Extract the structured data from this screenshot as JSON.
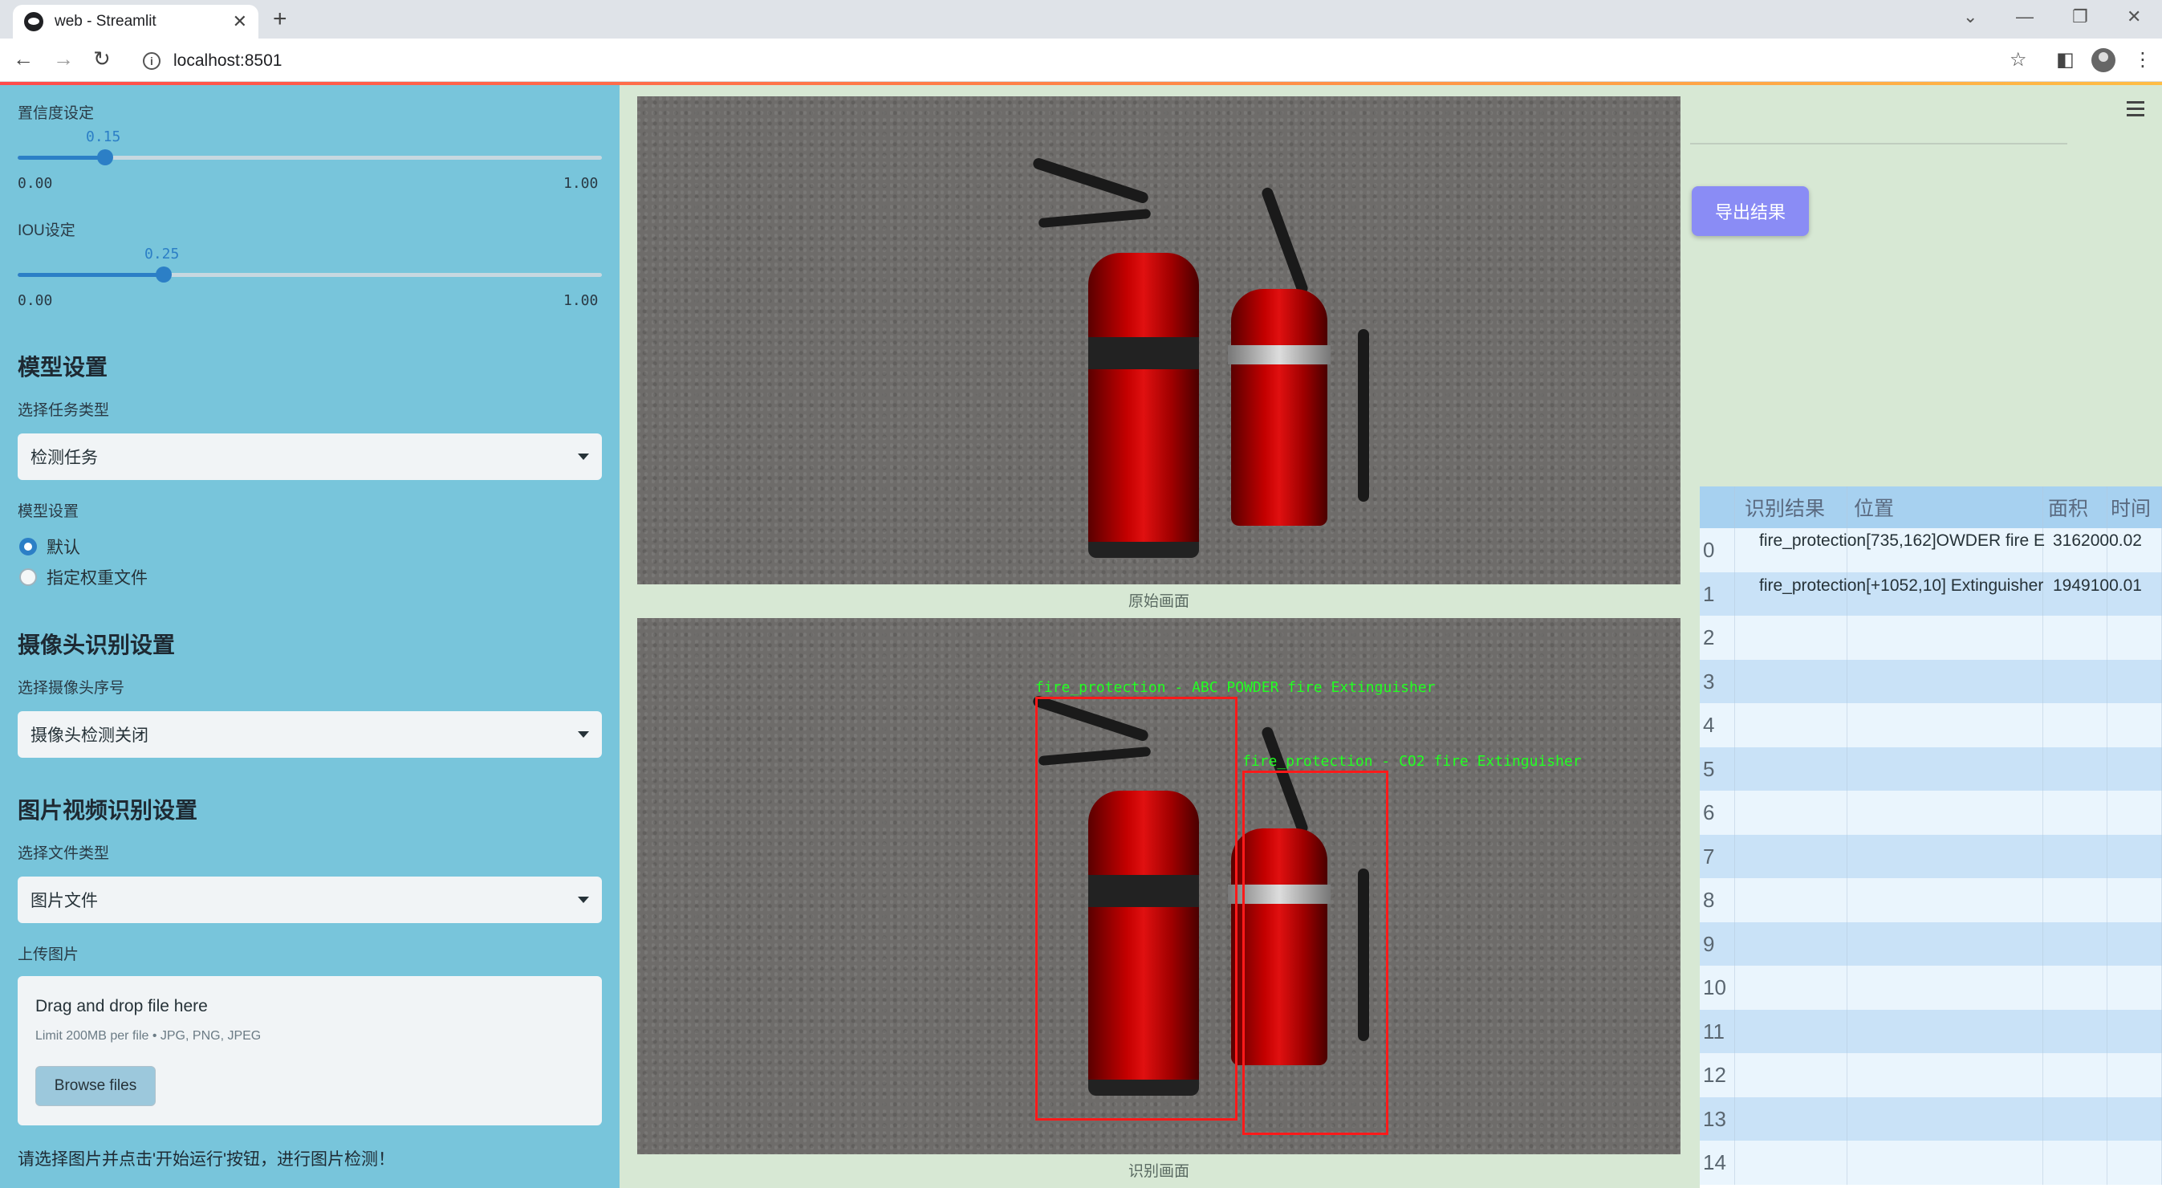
{
  "browser": {
    "tab_title": "web - Streamlit",
    "url": "localhost:8501"
  },
  "sidebar": {
    "confidence": {
      "label": "置信度设定",
      "value": "0.15",
      "min": "0.00",
      "max": "1.00",
      "fraction": 0.15
    },
    "iou": {
      "label": "IOU设定",
      "value": "0.25",
      "min": "0.00",
      "max": "1.00",
      "fraction": 0.25
    },
    "model_section": "模型设置",
    "task_label": "选择任务类型",
    "task_value": "检测任务",
    "model_label": "模型设置",
    "model_options": [
      "默认",
      "指定权重文件"
    ],
    "model_selected": 0,
    "camera_section": "摄像头识别设置",
    "camera_label": "选择摄像头序号",
    "camera_value": "摄像头检测关闭",
    "media_section": "图片视频识别设置",
    "file_type_label": "选择文件类型",
    "file_type_value": "图片文件",
    "upload_label": "上传图片",
    "upload_drag": "Drag and drop file here",
    "upload_limit": "Limit 200MB per file • JPG, PNG, JPEG",
    "browse_label": "Browse files",
    "hint": "请选择图片并点击'开始运行'按钮，进行图片检测！"
  },
  "main": {
    "original_caption": "原始画面",
    "result_caption": "识别画面",
    "detections": [
      {
        "label": "fire_protection - ABC POWDER fire Extinguisher"
      },
      {
        "label": "fire_protection - CO2 fire Extinguisher"
      }
    ],
    "export_label": "导出结果"
  },
  "results_table": {
    "headers": [
      "",
      "识别结果",
      "位置",
      "面积",
      "时间"
    ],
    "rows": [
      {
        "index": "0",
        "result": "fire_protection",
        "overlay": "[735,162]OWDER fire E",
        "area": "31620",
        "time": "00.02"
      },
      {
        "index": "1",
        "result": "fire_protection",
        "overlay": "[+1052,10] Extinguisher",
        "area": "19491",
        "time": "00.01"
      },
      {
        "index": "2"
      },
      {
        "index": "3"
      },
      {
        "index": "4"
      },
      {
        "index": "5"
      },
      {
        "index": "6"
      },
      {
        "index": "7"
      },
      {
        "index": "8"
      },
      {
        "index": "9"
      },
      {
        "index": "10"
      },
      {
        "index": "11"
      },
      {
        "index": "12"
      },
      {
        "index": "13"
      },
      {
        "index": "14"
      }
    ]
  }
}
